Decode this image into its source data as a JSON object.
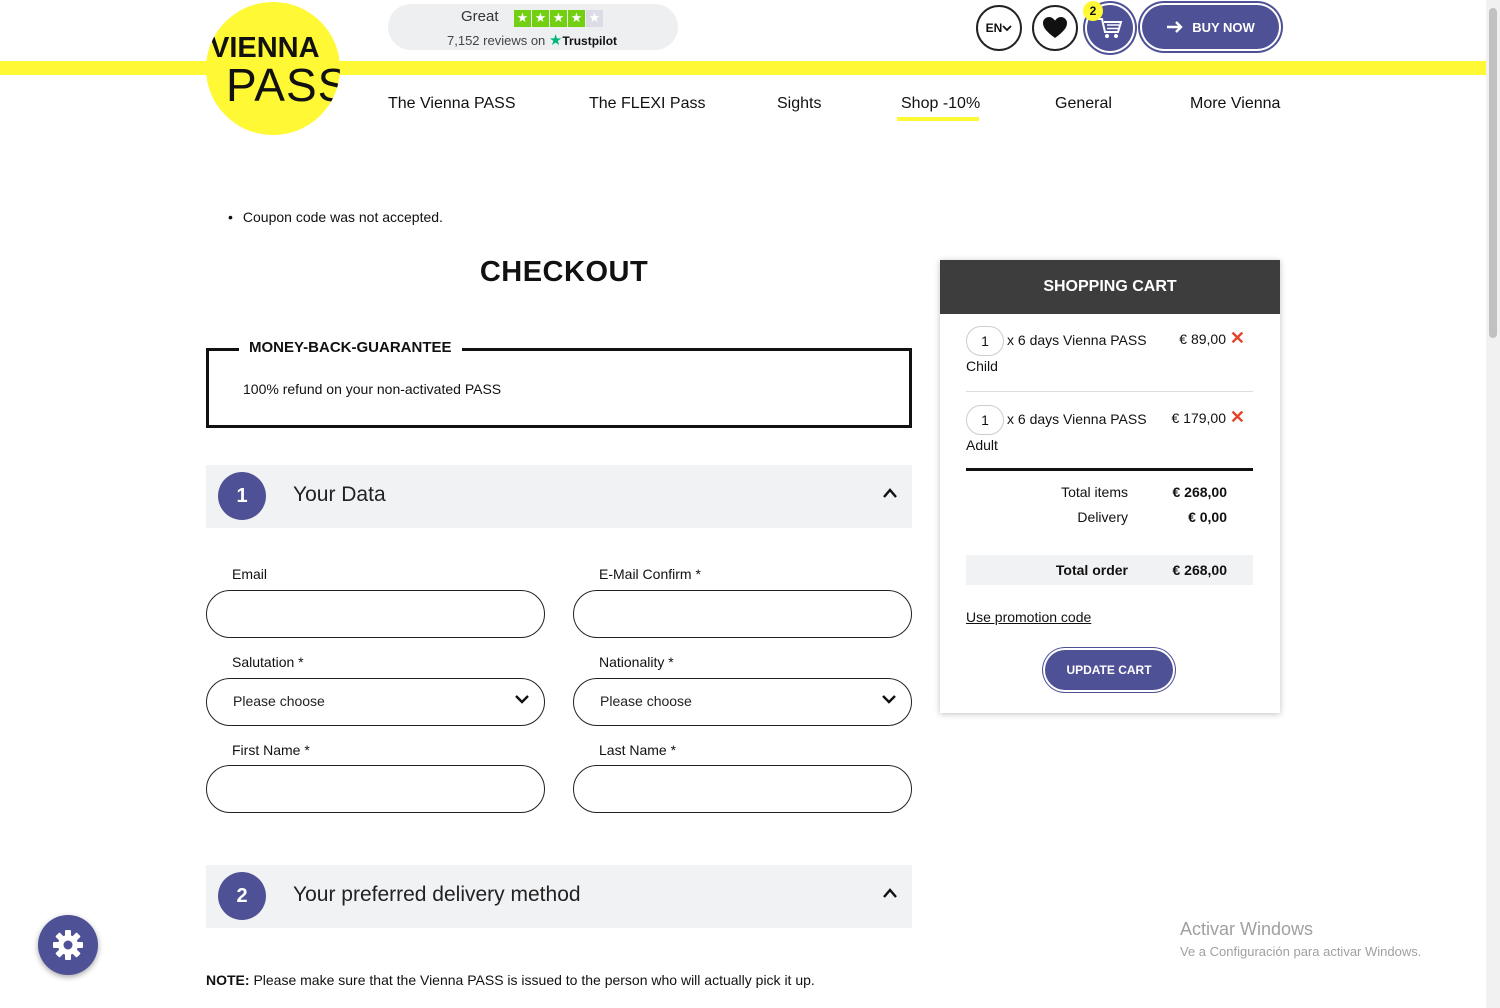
{
  "header": {
    "logo_top": "VIENNA",
    "logo_bottom": "PASS",
    "trustpilot": {
      "rating_word": "Great",
      "reviews_text": "7,152 reviews on",
      "brand": "Trustpilot",
      "stars_filled": 4,
      "stars_total": 5
    },
    "language": "EN",
    "cart_count": "2",
    "buy_now_label": "BUY NOW"
  },
  "nav": {
    "items": [
      {
        "label": "The Vienna PASS"
      },
      {
        "label": "The FLEXI Pass"
      },
      {
        "label": "Sights"
      },
      {
        "label": "Shop -10%"
      },
      {
        "label": "General"
      },
      {
        "label": "More Vienna"
      }
    ],
    "active": "Shop -10%"
  },
  "messages": {
    "coupon": "Coupon code was not accepted."
  },
  "checkout": {
    "title": "CHECKOUT",
    "guarantee": {
      "title": "MONEY-BACK-GUARANTEE",
      "text": "100% refund on your non-activated PASS"
    },
    "steps": [
      {
        "num": "1",
        "title": "Your Data"
      },
      {
        "num": "2",
        "title": "Your preferred delivery method"
      }
    ],
    "form": {
      "email_label": "Email",
      "email_confirm_label": "E-Mail Confirm *",
      "salutation_label": "Salutation *",
      "salutation_value": "Please choose",
      "nationality_label": "Nationality *",
      "nationality_value": "Please choose",
      "first_name_label": "First Name *",
      "last_name_label": "Last Name *"
    },
    "note_bold": "NOTE:",
    "note_text": " Please make sure that the Vienna PASS is issued to the person who will actually pick it up."
  },
  "cart": {
    "title": "SHOPPING CART",
    "items": [
      {
        "qty": "1",
        "name": "x 6 days Vienna PASS",
        "type": "Child",
        "price": "€ 89,00"
      },
      {
        "qty": "1",
        "name": "x 6 days Vienna PASS",
        "type": "Adult",
        "price": "€ 179,00"
      }
    ],
    "total_items_label": "Total items",
    "total_items_value": "€ 268,00",
    "delivery_label": "Delivery",
    "delivery_value": "€ 0,00",
    "total_order_label": "Total order",
    "total_order_value": "€ 268,00",
    "promo_link": "Use promotion code",
    "update_label": "UPDATE CART"
  },
  "watermark": {
    "line1": "Activar Windows",
    "line2": "Ve a Configuración para activar Windows."
  },
  "colors": {
    "accent": "#4f5196",
    "brand_yellow": "#fff835",
    "remove_red": "#e0452c",
    "cart_header": "#3d3d3d"
  }
}
